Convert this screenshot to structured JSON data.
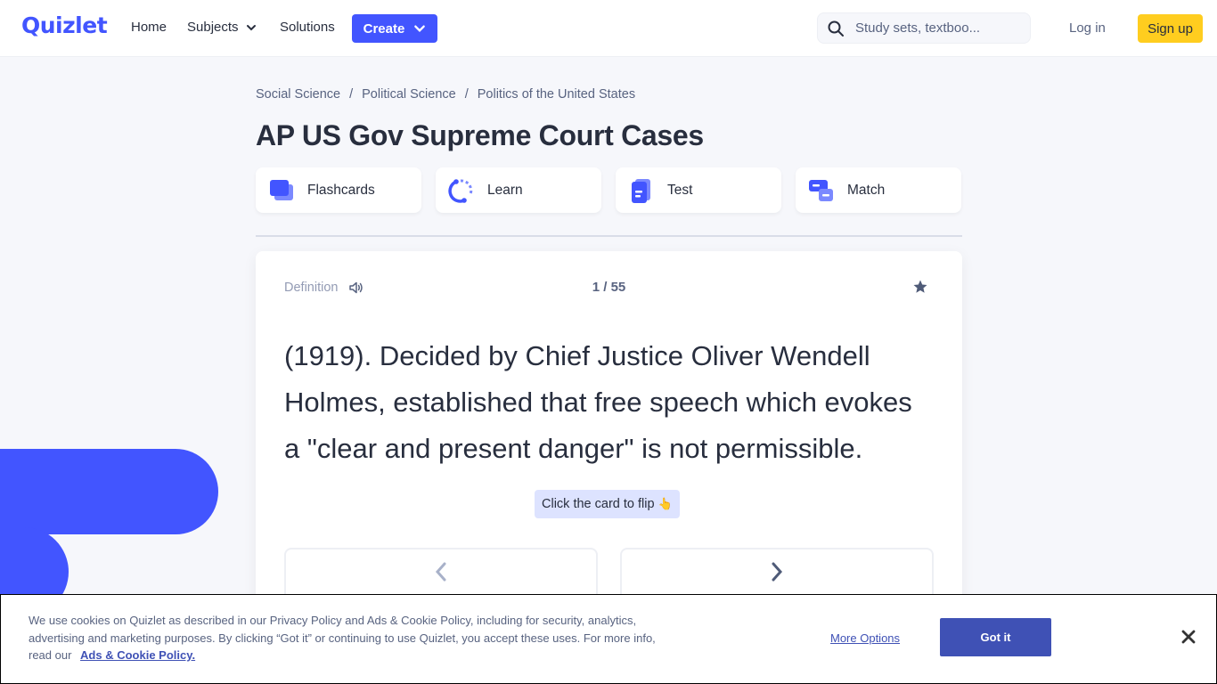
{
  "header": {
    "logo": "Quizlet",
    "nav": {
      "home": "Home",
      "subjects": "Subjects",
      "solutions": "Solutions"
    },
    "create_label": "Create",
    "search": {
      "placeholder": "Study sets, textboo...",
      "icon": "search-icon"
    },
    "login_label": "Log in",
    "signup_label": "Sign up"
  },
  "breadcrumb": [
    "Social Science",
    "Political Science",
    "Politics of the United States"
  ],
  "breadcrumb_separator": "/",
  "page_title": "AP US Gov Supreme Court Cases",
  "modes": [
    {
      "label": "Flashcards",
      "icon": "flashcards-icon"
    },
    {
      "label": "Learn",
      "icon": "learn-icon"
    },
    {
      "label": "Test",
      "icon": "test-icon"
    },
    {
      "label": "Match",
      "icon": "match-icon"
    }
  ],
  "card": {
    "side_label": "Definition",
    "counter": "1 / 55",
    "text": "(1919). Decided by Chief Justice Oliver Wendell Holmes, established that free speech which evokes a \"clear and present danger\" is not permissible.",
    "flip_hint": "Click the card to flip",
    "flip_hint_emoji": "👆"
  },
  "cookie_banner": {
    "text": "We use cookies on Quizlet as described in our Privacy Policy and Ads & Cookie Policy, including for security, analytics, advertising and marketing purposes. By clicking “Got it” or continuing to use Quizlet, you accept these uses. For more info, read our",
    "link": "Ads & Cookie Policy.",
    "more_options": "More Options",
    "accept": "Got it"
  },
  "colors": {
    "brand": "#4255ff",
    "signup": "#ffcd1f",
    "cookie_button": "#3f51b5",
    "background": "#f6f7fb"
  }
}
